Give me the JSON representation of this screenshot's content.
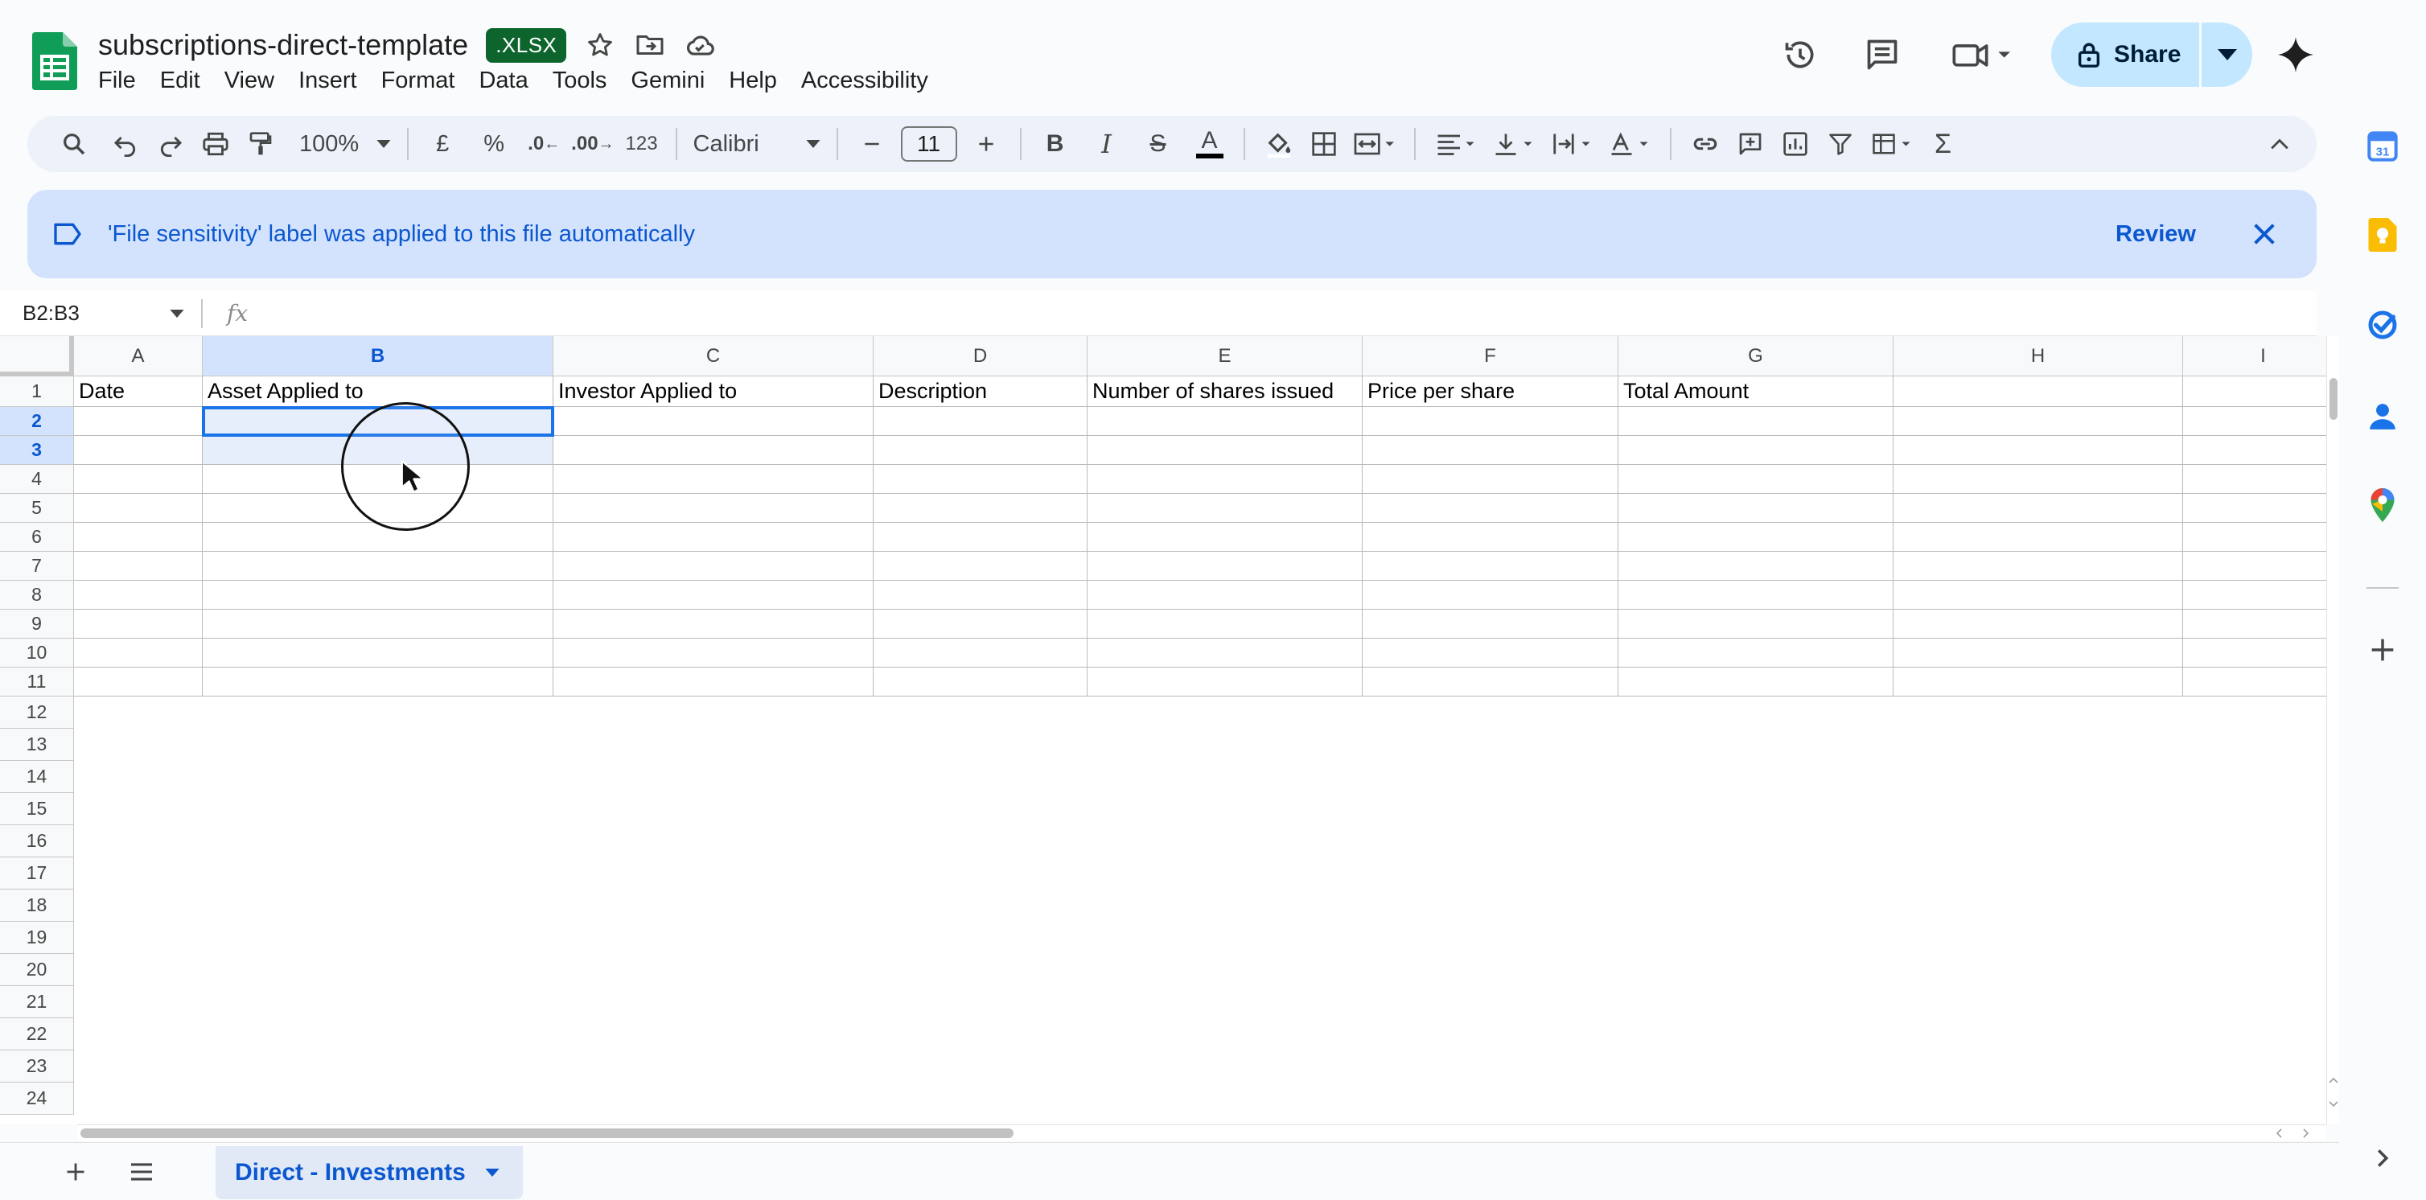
{
  "document": {
    "title": "subscriptions-direct-template",
    "badge": ".XLSX"
  },
  "menu": [
    "File",
    "Edit",
    "View",
    "Insert",
    "Format",
    "Data",
    "Tools",
    "Gemini",
    "Help",
    "Accessibility"
  ],
  "header": {
    "share_label": "Share"
  },
  "toolbar": {
    "zoom": "100%",
    "currency": "£",
    "percent": "%",
    "decrease_decimal": ".0",
    "increase_decimal": ".00",
    "number_format": "123",
    "font": "Calibri",
    "font_size": "11",
    "bold": "B",
    "italic": "I",
    "strike": "S",
    "text_color": "A",
    "sigma": "Σ"
  },
  "banner": {
    "message": "'File sensitivity' label was applied to this file automatically",
    "review": "Review"
  },
  "formula_bar": {
    "name_box": "B2:B3",
    "fx": "fx",
    "value": ""
  },
  "grid": {
    "columns": [
      "A",
      "B",
      "C",
      "D",
      "E",
      "F",
      "G",
      "H",
      "I"
    ],
    "selected_column": "B",
    "selected_rows": [
      "2",
      "3"
    ],
    "rows": [
      "1",
      "2",
      "3",
      "4",
      "5",
      "6",
      "7",
      "8",
      "9",
      "10",
      "11",
      "12",
      "13",
      "14",
      "15",
      "16",
      "17",
      "18",
      "19",
      "20",
      "21",
      "22",
      "23",
      "24"
    ],
    "header_row": [
      "Date",
      "Asset Applied to",
      "Investor Applied to",
      "Description",
      "Number of shares issued",
      "Price per share",
      "Total Amount",
      "",
      ""
    ]
  },
  "sheets": {
    "active": "Direct - Investments"
  },
  "colors": {
    "accent": "#0b57d0",
    "share_bg": "#c2e7ff",
    "banner_bg": "#d3e3fd",
    "xlsx_badge": "#0d652d",
    "sheets_green": "#0f9d58"
  }
}
